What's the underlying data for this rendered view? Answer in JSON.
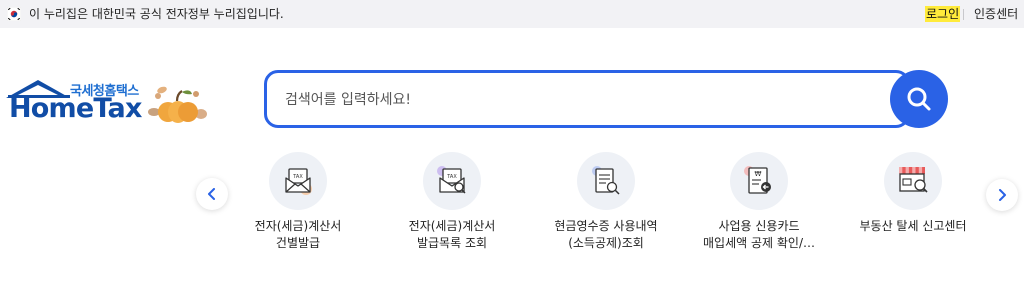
{
  "gov_bar": {
    "notice": "이 누리집은 대한민국 공식 전자정부 누리집입니다.",
    "login": "로그인",
    "cert_center": "인증센터"
  },
  "logo": {
    "sub": "국세청홈택스",
    "main": "HomeTax"
  },
  "search": {
    "placeholder": "검색어를 입력하세요!"
  },
  "quick_menu": {
    "items": [
      {
        "label": "전자(세금)계산서\n건별발급",
        "icon": "tax-invoice-envelope-icon"
      },
      {
        "label": "전자(세금)계산서\n발급목록 조회",
        "icon": "tax-invoice-search-icon"
      },
      {
        "label": "현금영수증 사용내역\n(소득공제)조회",
        "icon": "cash-receipt-search-icon"
      },
      {
        "label": "사업용 신용카드\n매입세액 공제 확인/…",
        "icon": "business-card-receipt-icon"
      },
      {
        "label": "부동산 탈세 신고센터",
        "icon": "store-search-icon"
      }
    ]
  },
  "colors": {
    "accent": "#2a62e6",
    "logo_blue": "#114da6",
    "login_highlight": "#ffeb3b"
  }
}
